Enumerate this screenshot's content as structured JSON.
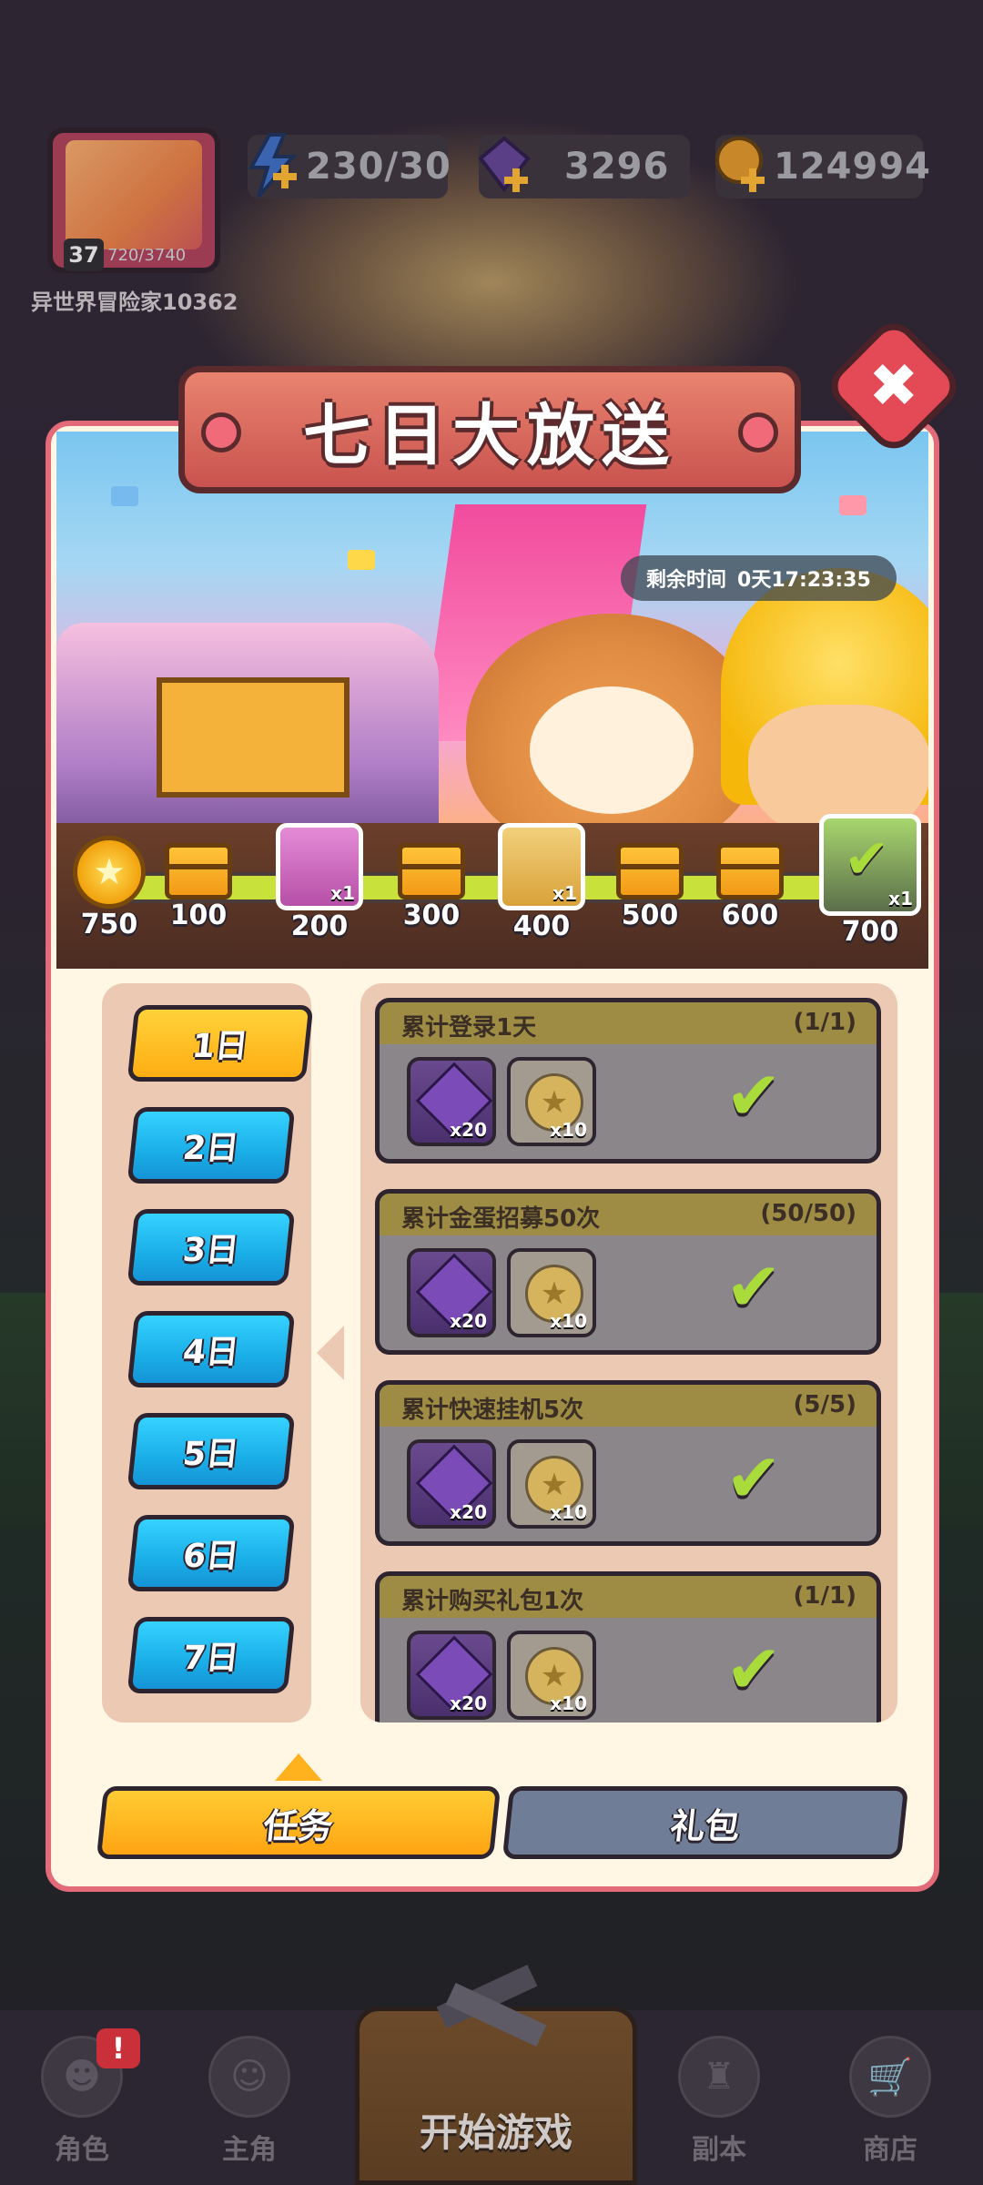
{
  "hud": {
    "player_name": "异世界冒险家10362",
    "level": "37",
    "xp": "720/3740",
    "energy": "230/30",
    "gems": "3296",
    "gold": "124994"
  },
  "modal": {
    "title": "七日大放送",
    "close_label": "✖",
    "timer_label": "剩余时间",
    "timer_value": "0天17:23:35",
    "rewards": [
      {
        "label": "750",
        "kind": "coin",
        "qty": ""
      },
      {
        "label": "100",
        "kind": "chest",
        "qty": ""
      },
      {
        "label": "200",
        "kind": "hero",
        "qty": "x1"
      },
      {
        "label": "300",
        "kind": "chest",
        "qty": ""
      },
      {
        "label": "400",
        "kind": "hero",
        "qty": "x1"
      },
      {
        "label": "500",
        "kind": "chest",
        "qty": ""
      },
      {
        "label": "600",
        "kind": "chest",
        "qty": ""
      },
      {
        "label": "700",
        "kind": "hero-claimed",
        "qty": "x1"
      }
    ],
    "progress_fraction": 1.0,
    "days": [
      "1日",
      "2日",
      "3日",
      "4日",
      "5日",
      "6日",
      "7日"
    ],
    "active_day": "1日",
    "tasks": [
      {
        "title": "累计登录1天",
        "progress": "(1/1)",
        "gem_qty": "x20",
        "star_qty": "x10"
      },
      {
        "title": "累计金蛋招募50次",
        "progress": "(50/50)",
        "gem_qty": "x20",
        "star_qty": "x10"
      },
      {
        "title": "累计快速挂机5次",
        "progress": "(5/5)",
        "gem_qty": "x20",
        "star_qty": "x10"
      },
      {
        "title": "累计购买礼包1次",
        "progress": "(1/1)",
        "gem_qty": "x20",
        "star_qty": "x10"
      }
    ],
    "tabs": {
      "task": "任务",
      "pack": "礼包"
    }
  },
  "nav": {
    "role": "角色",
    "hero": "主角",
    "start": "开始游戏",
    "dungeon": "副本",
    "shop": "商店",
    "badge": "!"
  },
  "colors": {
    "accent_orange": "#ffad12",
    "day_blue": "#1aaee8",
    "check_green": "#a9dc3a",
    "close_red": "#e34a55"
  }
}
